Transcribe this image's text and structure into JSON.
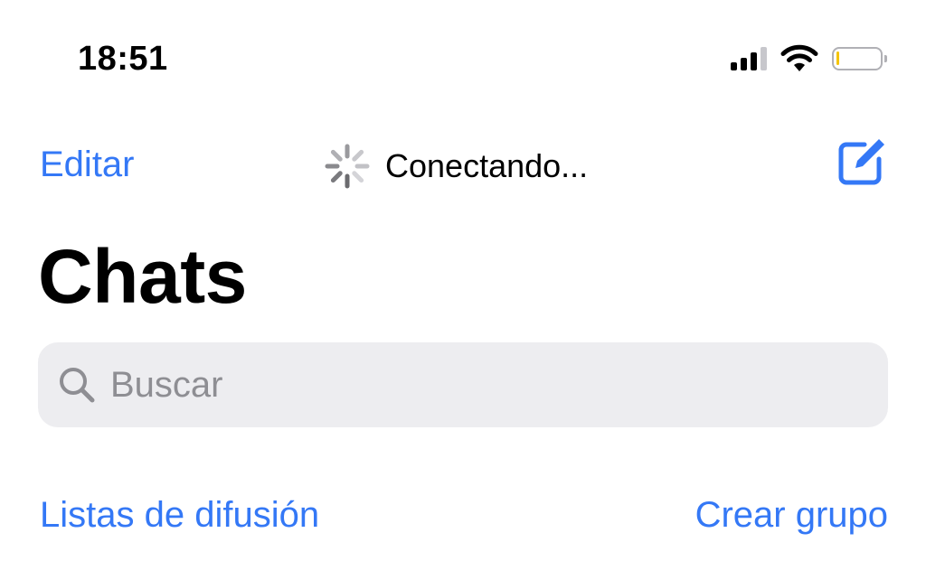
{
  "status_bar": {
    "time": "18:51",
    "signal_icon": "cellular-signal-icon",
    "wifi_icon": "wifi-icon",
    "battery_icon": "battery-icon",
    "battery_level": 0.05
  },
  "nav": {
    "edit_label": "Editar",
    "connecting_text": "Conectando...",
    "spinner_icon": "activity-spinner-icon",
    "compose_icon": "compose-icon"
  },
  "title": "Chats",
  "search": {
    "placeholder": "Buscar",
    "value": "",
    "icon": "search-icon"
  },
  "actions": {
    "broadcast_lists": "Listas de difusión",
    "new_group": "Crear grupo"
  },
  "colors": {
    "accent": "#3478f6",
    "search_bg": "#ededf0",
    "battery_low": "#f5c400"
  }
}
